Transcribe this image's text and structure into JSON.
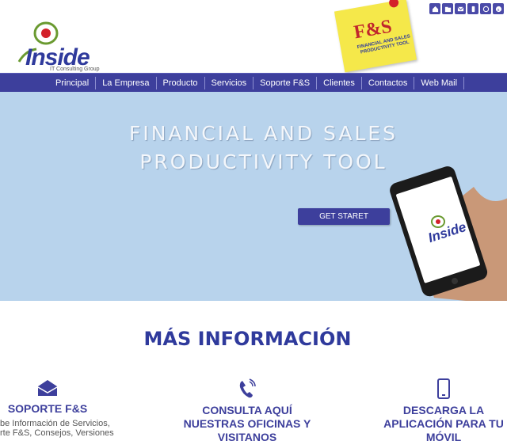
{
  "header": {
    "logo_text": "Inside",
    "logo_subtext": "IT Consulting Group",
    "note_title": "F&S",
    "note_subtitle": "FINANCIAL AND SALES PRODUCTIVITY TOOL",
    "top_icons": [
      "home-icon",
      "folder-icon",
      "mail-icon",
      "phone-icon",
      "whatsapp-icon",
      "skype-icon"
    ]
  },
  "nav": {
    "items": [
      "Principal",
      "La Empresa",
      "Producto",
      "Servicios",
      "Soporte F&S",
      "Clientes",
      "Contactos",
      "Web Mail"
    ]
  },
  "hero": {
    "title_line1": "FINANCIAL AND SALES",
    "title_line2": "PRODUCTIVITY TOOL",
    "cta_label": "GET STARET",
    "phone_logo": "Inside"
  },
  "info": {
    "title": "MÁS INFORMACIÓN",
    "columns": [
      {
        "title": "SOPORTE F&S",
        "text": "be Información de Servicios, rte F&S, Consejos, Versiones",
        "icon": "envelope-icon"
      },
      {
        "title": "CONSULTA AQUÍ NUESTRAS OFICINAS Y VISITANOS",
        "text": "",
        "icon": "phone-call-icon"
      },
      {
        "title": "DESCARGA LA APLICACIÓN PARA TU MÓVIL",
        "text": "",
        "icon": "mobile-icon"
      }
    ]
  },
  "colors": {
    "primary": "#3d3f9c",
    "hero_bg": "#b8d3ec",
    "note": "#f5e84a",
    "accent_red": "#c0262c"
  }
}
